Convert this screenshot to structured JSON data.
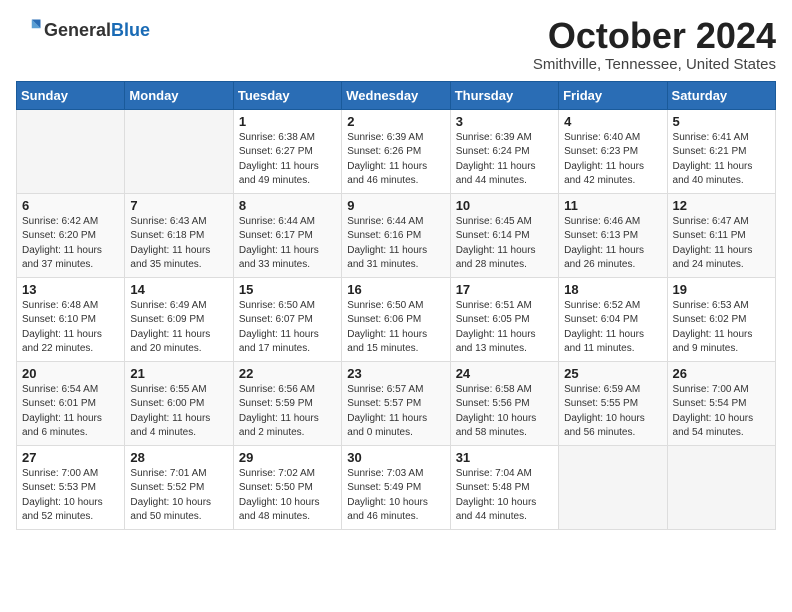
{
  "header": {
    "logo_general": "General",
    "logo_blue": "Blue",
    "month_title": "October 2024",
    "location": "Smithville, Tennessee, United States"
  },
  "calendar": {
    "days_of_week": [
      "Sunday",
      "Monday",
      "Tuesday",
      "Wednesday",
      "Thursday",
      "Friday",
      "Saturday"
    ],
    "weeks": [
      [
        {
          "day": "",
          "detail": ""
        },
        {
          "day": "",
          "detail": ""
        },
        {
          "day": "1",
          "detail": "Sunrise: 6:38 AM\nSunset: 6:27 PM\nDaylight: 11 hours and 49 minutes."
        },
        {
          "day": "2",
          "detail": "Sunrise: 6:39 AM\nSunset: 6:26 PM\nDaylight: 11 hours and 46 minutes."
        },
        {
          "day": "3",
          "detail": "Sunrise: 6:39 AM\nSunset: 6:24 PM\nDaylight: 11 hours and 44 minutes."
        },
        {
          "day": "4",
          "detail": "Sunrise: 6:40 AM\nSunset: 6:23 PM\nDaylight: 11 hours and 42 minutes."
        },
        {
          "day": "5",
          "detail": "Sunrise: 6:41 AM\nSunset: 6:21 PM\nDaylight: 11 hours and 40 minutes."
        }
      ],
      [
        {
          "day": "6",
          "detail": "Sunrise: 6:42 AM\nSunset: 6:20 PM\nDaylight: 11 hours and 37 minutes."
        },
        {
          "day": "7",
          "detail": "Sunrise: 6:43 AM\nSunset: 6:18 PM\nDaylight: 11 hours and 35 minutes."
        },
        {
          "day": "8",
          "detail": "Sunrise: 6:44 AM\nSunset: 6:17 PM\nDaylight: 11 hours and 33 minutes."
        },
        {
          "day": "9",
          "detail": "Sunrise: 6:44 AM\nSunset: 6:16 PM\nDaylight: 11 hours and 31 minutes."
        },
        {
          "day": "10",
          "detail": "Sunrise: 6:45 AM\nSunset: 6:14 PM\nDaylight: 11 hours and 28 minutes."
        },
        {
          "day": "11",
          "detail": "Sunrise: 6:46 AM\nSunset: 6:13 PM\nDaylight: 11 hours and 26 minutes."
        },
        {
          "day": "12",
          "detail": "Sunrise: 6:47 AM\nSunset: 6:11 PM\nDaylight: 11 hours and 24 minutes."
        }
      ],
      [
        {
          "day": "13",
          "detail": "Sunrise: 6:48 AM\nSunset: 6:10 PM\nDaylight: 11 hours and 22 minutes."
        },
        {
          "day": "14",
          "detail": "Sunrise: 6:49 AM\nSunset: 6:09 PM\nDaylight: 11 hours and 20 minutes."
        },
        {
          "day": "15",
          "detail": "Sunrise: 6:50 AM\nSunset: 6:07 PM\nDaylight: 11 hours and 17 minutes."
        },
        {
          "day": "16",
          "detail": "Sunrise: 6:50 AM\nSunset: 6:06 PM\nDaylight: 11 hours and 15 minutes."
        },
        {
          "day": "17",
          "detail": "Sunrise: 6:51 AM\nSunset: 6:05 PM\nDaylight: 11 hours and 13 minutes."
        },
        {
          "day": "18",
          "detail": "Sunrise: 6:52 AM\nSunset: 6:04 PM\nDaylight: 11 hours and 11 minutes."
        },
        {
          "day": "19",
          "detail": "Sunrise: 6:53 AM\nSunset: 6:02 PM\nDaylight: 11 hours and 9 minutes."
        }
      ],
      [
        {
          "day": "20",
          "detail": "Sunrise: 6:54 AM\nSunset: 6:01 PM\nDaylight: 11 hours and 6 minutes."
        },
        {
          "day": "21",
          "detail": "Sunrise: 6:55 AM\nSunset: 6:00 PM\nDaylight: 11 hours and 4 minutes."
        },
        {
          "day": "22",
          "detail": "Sunrise: 6:56 AM\nSunset: 5:59 PM\nDaylight: 11 hours and 2 minutes."
        },
        {
          "day": "23",
          "detail": "Sunrise: 6:57 AM\nSunset: 5:57 PM\nDaylight: 11 hours and 0 minutes."
        },
        {
          "day": "24",
          "detail": "Sunrise: 6:58 AM\nSunset: 5:56 PM\nDaylight: 10 hours and 58 minutes."
        },
        {
          "day": "25",
          "detail": "Sunrise: 6:59 AM\nSunset: 5:55 PM\nDaylight: 10 hours and 56 minutes."
        },
        {
          "day": "26",
          "detail": "Sunrise: 7:00 AM\nSunset: 5:54 PM\nDaylight: 10 hours and 54 minutes."
        }
      ],
      [
        {
          "day": "27",
          "detail": "Sunrise: 7:00 AM\nSunset: 5:53 PM\nDaylight: 10 hours and 52 minutes."
        },
        {
          "day": "28",
          "detail": "Sunrise: 7:01 AM\nSunset: 5:52 PM\nDaylight: 10 hours and 50 minutes."
        },
        {
          "day": "29",
          "detail": "Sunrise: 7:02 AM\nSunset: 5:50 PM\nDaylight: 10 hours and 48 minutes."
        },
        {
          "day": "30",
          "detail": "Sunrise: 7:03 AM\nSunset: 5:49 PM\nDaylight: 10 hours and 46 minutes."
        },
        {
          "day": "31",
          "detail": "Sunrise: 7:04 AM\nSunset: 5:48 PM\nDaylight: 10 hours and 44 minutes."
        },
        {
          "day": "",
          "detail": ""
        },
        {
          "day": "",
          "detail": ""
        }
      ]
    ]
  }
}
